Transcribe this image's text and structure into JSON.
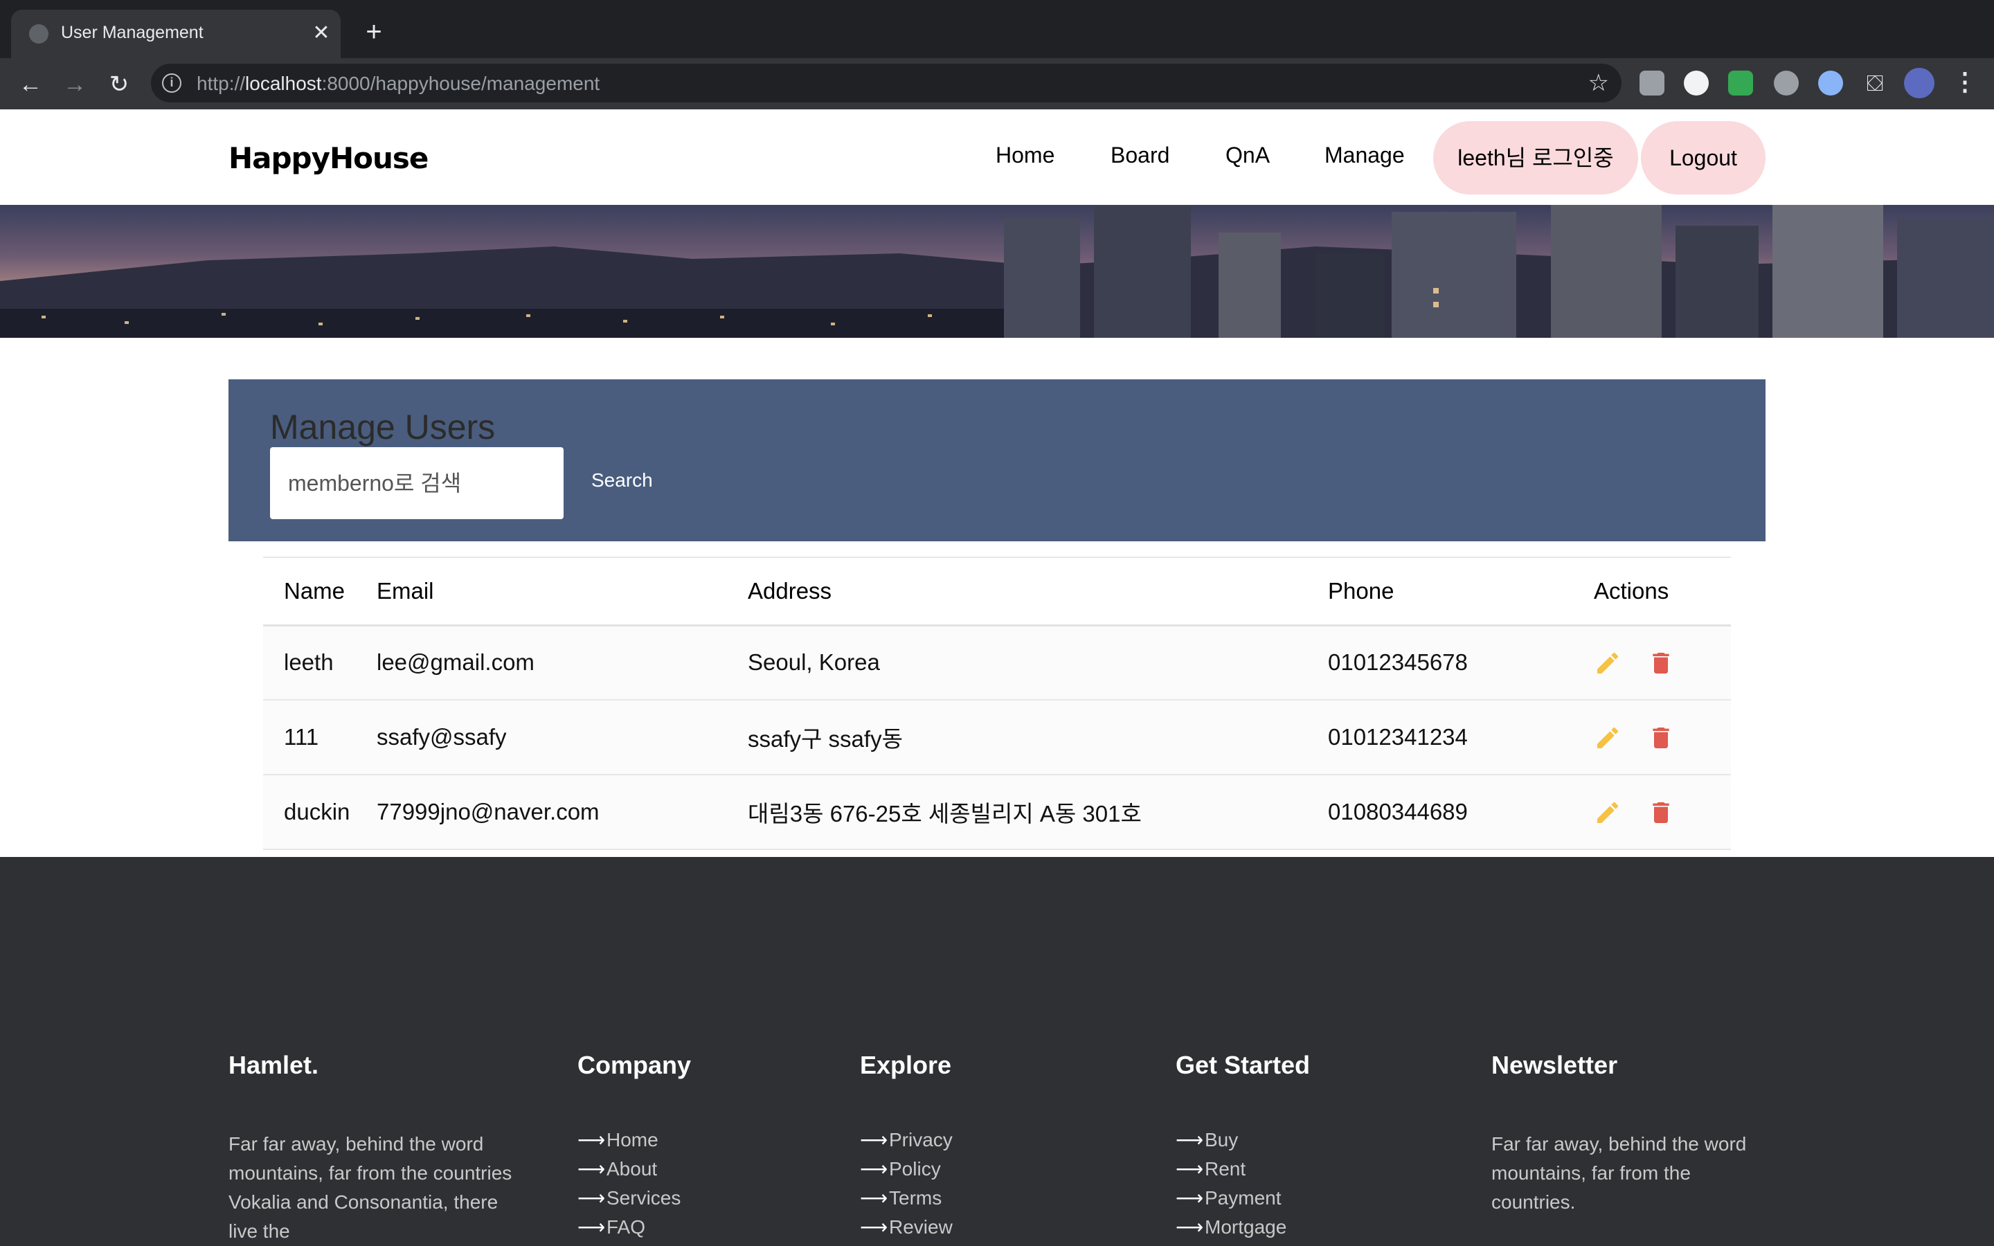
{
  "browser": {
    "tab_title": "User Management",
    "tab_close": "✕",
    "new_tab": "+",
    "url_prefix": "http://",
    "url_host": "localhost",
    "url_rest": ":8000/happyhouse/management"
  },
  "header": {
    "brand": "HappyHouse",
    "nav": [
      "Home",
      "Board",
      "QnA",
      "Manage"
    ],
    "user_status": "leeth님 로그인중",
    "logout": "Logout"
  },
  "manage": {
    "title": "Manage Users",
    "search_placeholder": "memberno로 검색",
    "search_button": "Search"
  },
  "table": {
    "columns": [
      "Name",
      "Email",
      "Address",
      "Phone",
      "Actions"
    ],
    "rows": [
      {
        "name": "leeth",
        "email": "lee@gmail.com",
        "address": "Seoul, Korea",
        "phone": "01012345678"
      },
      {
        "name": "111",
        "email": "ssafy@ssafy",
        "address": "ssafy구 ssafy동",
        "phone": "01012341234"
      },
      {
        "name": "duckin",
        "email": "77999jno@naver.com",
        "address": "대림3동 676-25호 세종빌리지 A동 301호",
        "phone": "01080344689"
      }
    ],
    "edit_color": "#f5c242",
    "delete_color": "#e05a4f"
  },
  "footer": {
    "brand": "Hamlet.",
    "brand_text": "Far far away, behind the word mountains, far from the countries Vokalia and Consonantia, there live the",
    "company": {
      "heading": "Company",
      "items": [
        "Home",
        "About",
        "Services",
        "FAQ"
      ]
    },
    "explore": {
      "heading": "Explore",
      "items": [
        "Privacy",
        "Policy",
        "Terms",
        "Review"
      ]
    },
    "get_started": {
      "heading": "Get Started",
      "items": [
        "Buy",
        "Rent",
        "Payment",
        "Mortgage"
      ]
    },
    "newsletter": {
      "heading": "Newsletter",
      "text": "Far far away, behind the word mountains, far from the countries."
    }
  },
  "colors": {
    "panel": "#4a5d7e",
    "pill": "#fadadd",
    "footer": "#2f3034"
  }
}
